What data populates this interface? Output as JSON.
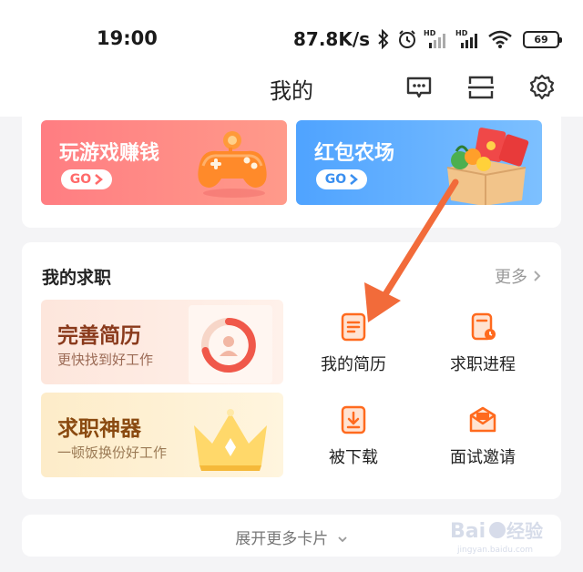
{
  "status_bar": {
    "time": "19:00",
    "speed": "87.8K/s",
    "battery": "69",
    "icons": [
      "bluetooth-icon",
      "alarm-icon",
      "signal-hd-icon",
      "signal-hd-icon",
      "wifi-icon",
      "battery-icon"
    ]
  },
  "header": {
    "title": "我的",
    "icons": [
      "customer-service-icon",
      "scan-icon",
      "settings-icon"
    ]
  },
  "promos": {
    "game": {
      "title": "玩游戏赚钱",
      "go": "GO"
    },
    "farm": {
      "title": "红包农场",
      "go": "GO"
    }
  },
  "job": {
    "title": "我的求职",
    "more": "更多",
    "features": {
      "resume": {
        "title": "完善简历",
        "subtitle": "更快找到好工作"
      },
      "tool": {
        "title": "求职神器",
        "subtitle": "一顿饭换份好工作"
      }
    },
    "grid": {
      "my_resume": "我的简历",
      "progress": "求职进程",
      "downloaded": "被下载",
      "interview": "面试邀请"
    }
  },
  "expand": {
    "label": "展开更多卡片"
  },
  "watermark": {
    "text": "Baidu 经验",
    "sub": "jingyan.baidu.com"
  },
  "colors": {
    "accent_orange": "#ff6a1e",
    "arrow": "#f26b3a",
    "promo_red": "#ff7d82",
    "promo_blue": "#4fa3ff"
  }
}
